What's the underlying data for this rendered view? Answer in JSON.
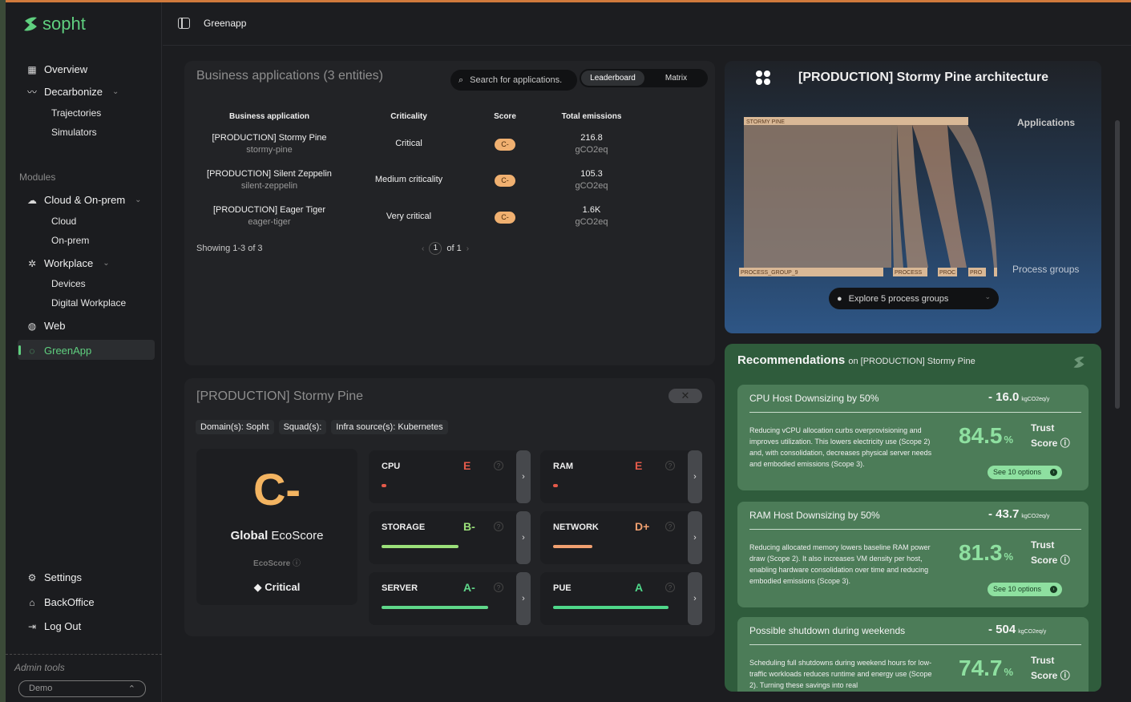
{
  "app": {
    "name": "sopht",
    "workspace": "Greenapp"
  },
  "sidebar": {
    "items": [
      {
        "label": "Overview",
        "icon": "grid-icon"
      },
      {
        "label": "Decarbonize",
        "icon": "trend-icon"
      },
      {
        "label": "Trajectories"
      },
      {
        "label": "Simulators"
      },
      {
        "label": "Modules"
      },
      {
        "label": "Cloud & On-prem",
        "icon": "cloud-icon"
      },
      {
        "label": "Cloud"
      },
      {
        "label": "On-prem"
      },
      {
        "label": "Workplace",
        "icon": "workplace-icon"
      },
      {
        "label": "Devices"
      },
      {
        "label": "Digital Workplace"
      },
      {
        "label": "Web",
        "icon": "globe-icon"
      },
      {
        "label": "GreenApp",
        "icon": "leaf-icon"
      },
      {
        "label": "Settings",
        "icon": "gear-icon"
      },
      {
        "label": "BackOffice",
        "icon": "backoffice-icon"
      },
      {
        "label": "Log Out",
        "icon": "logout-icon"
      }
    ],
    "admin_label": "Admin tools",
    "demo_select": "Demo"
  },
  "business_apps": {
    "title": "Business applications (3 entities)",
    "search_placeholder": "Search for applications.",
    "view_options": [
      "Leaderboard",
      "Matrix"
    ],
    "columns": [
      "Business application",
      "Criticality",
      "Score",
      "Total emissions"
    ],
    "rows": [
      {
        "name": "[PRODUCTION] Stormy Pine",
        "slug": "stormy-pine",
        "criticality": "Critical",
        "score": "C-",
        "emissions": "216.8",
        "unit": "gCO2eq"
      },
      {
        "name": "[PRODUCTION] Silent Zeppelin",
        "slug": "silent-zeppelin",
        "criticality": "Medium criticality",
        "score": "C-",
        "emissions": "105.3",
        "unit": "gCO2eq"
      },
      {
        "name": "[PRODUCTION] Eager Tiger",
        "slug": "eager-tiger",
        "criticality": "Very critical",
        "score": "C-",
        "emissions": "1.6K",
        "unit": "gCO2eq"
      }
    ],
    "showing": "Showing 1-3 of 3",
    "page": "1",
    "of": "of 1"
  },
  "detail": {
    "title": "[PRODUCTION] Stormy Pine",
    "close": "✕",
    "tags": [
      "Domain(s): Sopht",
      "Squad(s):",
      "Infra source(s): Kubernetes"
    ],
    "eco_grade": "C-",
    "eco_label_bold": "Global",
    "eco_label_rest": " EcoScore",
    "eco_sub": "EcoScore",
    "eco_criticality": "Critical",
    "metrics": [
      {
        "name": "CPU",
        "grade": "E",
        "color": "#e45a4a",
        "fill": 0.04
      },
      {
        "name": "RAM",
        "grade": "E",
        "color": "#e45a4a",
        "fill": 0.04
      },
      {
        "name": "STORAGE",
        "grade": "B-",
        "color": "#9be07a",
        "fill": 0.65
      },
      {
        "name": "NETWORK",
        "grade": "D+",
        "color": "#f0a070",
        "fill": 0.33
      },
      {
        "name": "SERVER",
        "grade": "A-",
        "color": "#5fd88a",
        "fill": 0.9
      },
      {
        "name": "PUE",
        "grade": "A",
        "color": "#4fd88a",
        "fill": 0.97
      }
    ]
  },
  "architecture": {
    "title": "[PRODUCTION] Stormy Pine architecture",
    "applications_label": "Applications",
    "process_groups_label": "Process groups",
    "app_node": "STORMY PINE",
    "process_nodes": [
      "PROCESS_GROUP_9",
      "PROCESS",
      "PROC",
      "PRO"
    ],
    "explore_label": "Explore 5 process groups"
  },
  "recommendations": {
    "title": "Recommendations",
    "subtitle": "on [PRODUCTION] Stormy Pine",
    "items": [
      {
        "title": "CPU Host Downsizing by 50%",
        "value": "- 16.0",
        "unit": "kgCO2eq/y",
        "description": "Reducing vCPU allocation curbs overprovisioning and improves utilization. This lowers electricity use (Scope 2) and, with consolidation, decreases physical server needs and embodied emissions (Scope 3).",
        "trust": "84.5",
        "button": "See 10 options"
      },
      {
        "title": "RAM Host Downsizing by 50%",
        "value": "- 43.7",
        "unit": "kgCO2eq/y",
        "description": "Reducing allocated memory lowers baseline RAM power draw (Scope 2). It also increases VM density per host, enabling hardware consolidation over time and reducing embodied emissions (Scope 3).",
        "trust": "81.3",
        "button": "See 10 options"
      },
      {
        "title": "Possible shutdown during weekends",
        "value": "- 504",
        "unit": "kgCO2eq/y",
        "description": "Scheduling full shutdowns during weekend hours for low-traffic workloads reduces runtime and energy use (Scope 2). Turning these savings into real",
        "trust": "74.7",
        "button": "See 10 options"
      }
    ],
    "pct_symbol": "%",
    "trust_label": "Trust",
    "score_label": "Score"
  }
}
